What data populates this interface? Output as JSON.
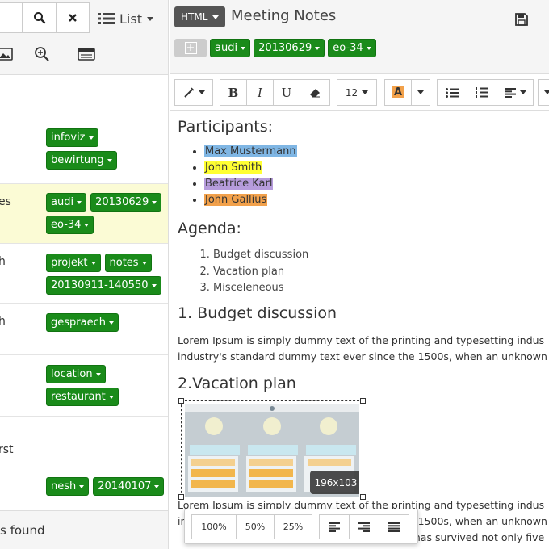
{
  "left": {
    "list_label": "List",
    "rows": [
      {
        "label": "",
        "tags": [
          "infoviz",
          "bewirtung"
        ]
      },
      {
        "label": "es",
        "tags": [
          "audi",
          "20130629",
          "eo-34"
        ]
      },
      {
        "label": "h",
        "tags": [
          "projekt",
          "notes",
          "20130911-140550"
        ]
      },
      {
        "label": "h",
        "tags": [
          "gespraech"
        ]
      },
      {
        "label": "",
        "tags": [
          "location",
          "restaurant"
        ]
      },
      {
        "label": "rst",
        "tags": []
      },
      {
        "label": "",
        "tags": [
          "nesh",
          "20140107"
        ]
      }
    ],
    "footer_text": "s found"
  },
  "right": {
    "mode_label": "HTML",
    "doc_title": "Meeting Notes",
    "add_tag_glyph": "+",
    "tags": [
      "audi",
      "20130629",
      "eo-34"
    ],
    "toolbar": {
      "bold": "B",
      "italic": "I",
      "underline": "U",
      "font_size": "12",
      "font_color": "A"
    },
    "editor": {
      "participants_heading": "Participants:",
      "participants": [
        {
          "name": "Max Mustermann",
          "color": "#7fb6e4"
        },
        {
          "name": "John Smith",
          "color": "#ffff33"
        },
        {
          "name": "Beatrice Karl",
          "color": "#b69cdc"
        },
        {
          "name": "John Gallius",
          "color": "#f2a14b"
        }
      ],
      "agenda_heading": "Agenda:",
      "agenda": [
        "Budget discussion",
        "Vacation plan",
        "Misceleneous"
      ],
      "budget_heading": "1. Budget discussion",
      "budget_lines": [
        "Lorem Ipsum is simply dummy text of the printing and typesetting indus",
        "industry's standard dummy text ever since the 1500s, when an unknown"
      ],
      "vacation_heading": "2.Vacation plan",
      "image_dims": "196x103",
      "after_image_lines": [
        "Lorem Ipsum is simply dummy text of the printing and typesetting indus",
        "industry's standard dummy text ever since the 1500s, when an unknown",
        "t has survived not only five"
      ],
      "image_popover": {
        "size_100": "100%",
        "size_50": "50%",
        "size_25": "25%"
      }
    }
  },
  "colors": {
    "tag_green": "#1a8b1a",
    "selected_row": "#fbfbd5"
  }
}
